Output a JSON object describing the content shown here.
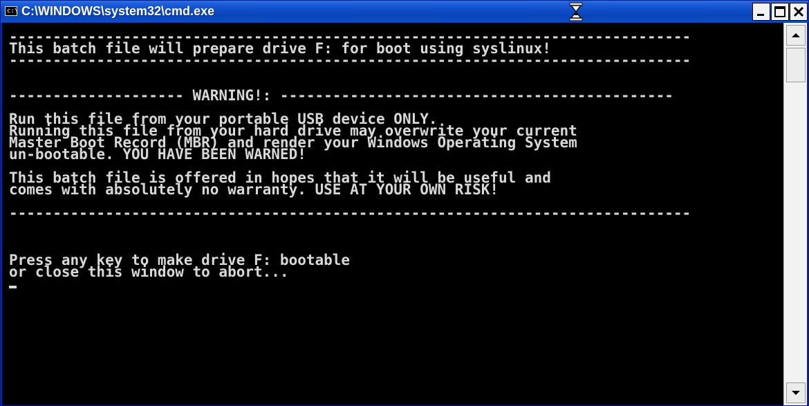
{
  "window": {
    "title": "C:\\WINDOWS\\system32\\cmd.exe",
    "icon": "cmd-icon",
    "icon_label": "c:\\"
  },
  "titlebar_controls": {
    "minimize": "minimize-icon",
    "maximize": "maximize-icon",
    "close": "close-icon"
  },
  "console": {
    "lines": [
      "------------------------------------------------------------------------------",
      "This batch file will prepare drive F: for boot using syslinux!",
      "------------------------------------------------------------------------------",
      "",
      "",
      "-------------------- WARNING!: ---------------------------------------------",
      "",
      "Run this file from your portable USB device ONLY.",
      "Running this file from your hard drive may overwrite your current",
      "Master Boot Record (MBR) and render your Windows Operating System",
      "un-bootable. YOU HAVE BEEN WARNED!",
      "",
      "This batch file is offered in hopes that it will be useful and",
      "comes with absolutely no warranty. USE AT YOUR OWN RISK!",
      "",
      "------------------------------------------------------------------------------",
      "",
      "",
      "",
      "Press any key to make drive F: bootable",
      "or close this window to abort..."
    ]
  },
  "scrollbar": {
    "up": "scroll-up-icon",
    "down": "scroll-down-icon"
  },
  "colors": {
    "titlebar": "#0f4cc6",
    "console_bg": "#000000",
    "console_text": "#d8d8d8"
  }
}
